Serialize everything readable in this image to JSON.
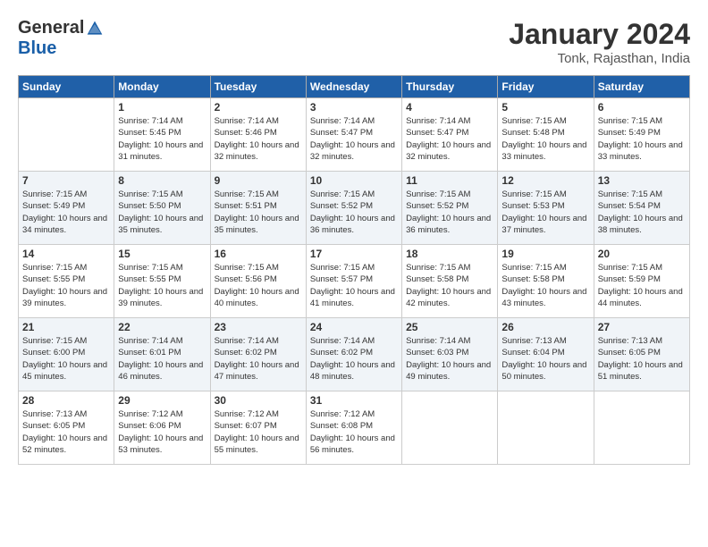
{
  "header": {
    "logo_general": "General",
    "logo_blue": "Blue",
    "title": "January 2024",
    "location": "Tonk, Rajasthan, India"
  },
  "days_of_week": [
    "Sunday",
    "Monday",
    "Tuesday",
    "Wednesday",
    "Thursday",
    "Friday",
    "Saturday"
  ],
  "weeks": [
    [
      {
        "day": "",
        "sunrise": "",
        "sunset": "",
        "daylight": ""
      },
      {
        "day": "1",
        "sunrise": "Sunrise: 7:14 AM",
        "sunset": "Sunset: 5:45 PM",
        "daylight": "Daylight: 10 hours and 31 minutes."
      },
      {
        "day": "2",
        "sunrise": "Sunrise: 7:14 AM",
        "sunset": "Sunset: 5:46 PM",
        "daylight": "Daylight: 10 hours and 32 minutes."
      },
      {
        "day": "3",
        "sunrise": "Sunrise: 7:14 AM",
        "sunset": "Sunset: 5:47 PM",
        "daylight": "Daylight: 10 hours and 32 minutes."
      },
      {
        "day": "4",
        "sunrise": "Sunrise: 7:14 AM",
        "sunset": "Sunset: 5:47 PM",
        "daylight": "Daylight: 10 hours and 32 minutes."
      },
      {
        "day": "5",
        "sunrise": "Sunrise: 7:15 AM",
        "sunset": "Sunset: 5:48 PM",
        "daylight": "Daylight: 10 hours and 33 minutes."
      },
      {
        "day": "6",
        "sunrise": "Sunrise: 7:15 AM",
        "sunset": "Sunset: 5:49 PM",
        "daylight": "Daylight: 10 hours and 33 minutes."
      }
    ],
    [
      {
        "day": "7",
        "sunrise": "Sunrise: 7:15 AM",
        "sunset": "Sunset: 5:49 PM",
        "daylight": "Daylight: 10 hours and 34 minutes."
      },
      {
        "day": "8",
        "sunrise": "Sunrise: 7:15 AM",
        "sunset": "Sunset: 5:50 PM",
        "daylight": "Daylight: 10 hours and 35 minutes."
      },
      {
        "day": "9",
        "sunrise": "Sunrise: 7:15 AM",
        "sunset": "Sunset: 5:51 PM",
        "daylight": "Daylight: 10 hours and 35 minutes."
      },
      {
        "day": "10",
        "sunrise": "Sunrise: 7:15 AM",
        "sunset": "Sunset: 5:52 PM",
        "daylight": "Daylight: 10 hours and 36 minutes."
      },
      {
        "day": "11",
        "sunrise": "Sunrise: 7:15 AM",
        "sunset": "Sunset: 5:52 PM",
        "daylight": "Daylight: 10 hours and 36 minutes."
      },
      {
        "day": "12",
        "sunrise": "Sunrise: 7:15 AM",
        "sunset": "Sunset: 5:53 PM",
        "daylight": "Daylight: 10 hours and 37 minutes."
      },
      {
        "day": "13",
        "sunrise": "Sunrise: 7:15 AM",
        "sunset": "Sunset: 5:54 PM",
        "daylight": "Daylight: 10 hours and 38 minutes."
      }
    ],
    [
      {
        "day": "14",
        "sunrise": "Sunrise: 7:15 AM",
        "sunset": "Sunset: 5:55 PM",
        "daylight": "Daylight: 10 hours and 39 minutes."
      },
      {
        "day": "15",
        "sunrise": "Sunrise: 7:15 AM",
        "sunset": "Sunset: 5:55 PM",
        "daylight": "Daylight: 10 hours and 39 minutes."
      },
      {
        "day": "16",
        "sunrise": "Sunrise: 7:15 AM",
        "sunset": "Sunset: 5:56 PM",
        "daylight": "Daylight: 10 hours and 40 minutes."
      },
      {
        "day": "17",
        "sunrise": "Sunrise: 7:15 AM",
        "sunset": "Sunset: 5:57 PM",
        "daylight": "Daylight: 10 hours and 41 minutes."
      },
      {
        "day": "18",
        "sunrise": "Sunrise: 7:15 AM",
        "sunset": "Sunset: 5:58 PM",
        "daylight": "Daylight: 10 hours and 42 minutes."
      },
      {
        "day": "19",
        "sunrise": "Sunrise: 7:15 AM",
        "sunset": "Sunset: 5:58 PM",
        "daylight": "Daylight: 10 hours and 43 minutes."
      },
      {
        "day": "20",
        "sunrise": "Sunrise: 7:15 AM",
        "sunset": "Sunset: 5:59 PM",
        "daylight": "Daylight: 10 hours and 44 minutes."
      }
    ],
    [
      {
        "day": "21",
        "sunrise": "Sunrise: 7:15 AM",
        "sunset": "Sunset: 6:00 PM",
        "daylight": "Daylight: 10 hours and 45 minutes."
      },
      {
        "day": "22",
        "sunrise": "Sunrise: 7:14 AM",
        "sunset": "Sunset: 6:01 PM",
        "daylight": "Daylight: 10 hours and 46 minutes."
      },
      {
        "day": "23",
        "sunrise": "Sunrise: 7:14 AM",
        "sunset": "Sunset: 6:02 PM",
        "daylight": "Daylight: 10 hours and 47 minutes."
      },
      {
        "day": "24",
        "sunrise": "Sunrise: 7:14 AM",
        "sunset": "Sunset: 6:02 PM",
        "daylight": "Daylight: 10 hours and 48 minutes."
      },
      {
        "day": "25",
        "sunrise": "Sunrise: 7:14 AM",
        "sunset": "Sunset: 6:03 PM",
        "daylight": "Daylight: 10 hours and 49 minutes."
      },
      {
        "day": "26",
        "sunrise": "Sunrise: 7:13 AM",
        "sunset": "Sunset: 6:04 PM",
        "daylight": "Daylight: 10 hours and 50 minutes."
      },
      {
        "day": "27",
        "sunrise": "Sunrise: 7:13 AM",
        "sunset": "Sunset: 6:05 PM",
        "daylight": "Daylight: 10 hours and 51 minutes."
      }
    ],
    [
      {
        "day": "28",
        "sunrise": "Sunrise: 7:13 AM",
        "sunset": "Sunset: 6:05 PM",
        "daylight": "Daylight: 10 hours and 52 minutes."
      },
      {
        "day": "29",
        "sunrise": "Sunrise: 7:12 AM",
        "sunset": "Sunset: 6:06 PM",
        "daylight": "Daylight: 10 hours and 53 minutes."
      },
      {
        "day": "30",
        "sunrise": "Sunrise: 7:12 AM",
        "sunset": "Sunset: 6:07 PM",
        "daylight": "Daylight: 10 hours and 55 minutes."
      },
      {
        "day": "31",
        "sunrise": "Sunrise: 7:12 AM",
        "sunset": "Sunset: 6:08 PM",
        "daylight": "Daylight: 10 hours and 56 minutes."
      },
      {
        "day": "",
        "sunrise": "",
        "sunset": "",
        "daylight": ""
      },
      {
        "day": "",
        "sunrise": "",
        "sunset": "",
        "daylight": ""
      },
      {
        "day": "",
        "sunrise": "",
        "sunset": "",
        "daylight": ""
      }
    ]
  ]
}
